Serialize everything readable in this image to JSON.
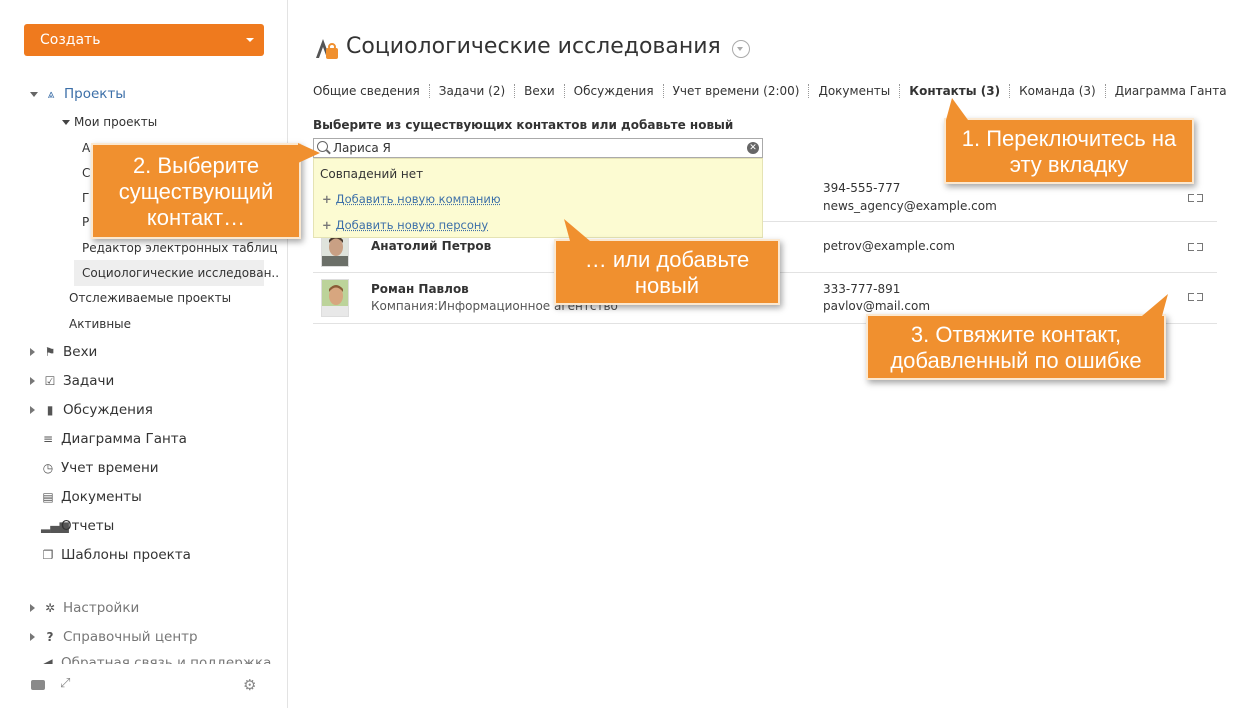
{
  "sidebar": {
    "create_label": "Создать",
    "projects_label": "Проекты",
    "my_projects_label": "Мои проекты",
    "project_items": [
      "А",
      "С",
      "Г",
      "Р",
      "Редактор электронных таблиц",
      "Социологические исследован.."
    ],
    "tracked_label": "Отслеживаемые проекты",
    "active_label": "Активные",
    "milestones_label": "Вехи",
    "tasks_label": "Задачи",
    "discussions_label": "Обсуждения",
    "gantt_label": "Диаграмма Ганта",
    "time_label": "Учет времени",
    "docs_label": "Документы",
    "reports_label": "Отчеты",
    "templates_label": "Шаблоны проекта",
    "settings_label": "Настройки",
    "help_label": "Справочный центр",
    "feedback_label": "Обратная связь и поддержка"
  },
  "page_title": "Социологические исследования",
  "tabs": [
    {
      "label": "Общие сведения"
    },
    {
      "label": "Задачи (2)"
    },
    {
      "label": "Вехи"
    },
    {
      "label": "Обсуждения"
    },
    {
      "label": "Учет времени (2:00)"
    },
    {
      "label": "Документы"
    },
    {
      "label": "Контакты (3)"
    },
    {
      "label": "Команда (3)"
    },
    {
      "label": "Диаграмма Ганта"
    }
  ],
  "hint": "Выберите из существующих контактов или добавьте новый",
  "search": {
    "value": "Лариса Я"
  },
  "dropdown": {
    "no_match": "Совпадений нет",
    "add_company": "Добавить новую компанию",
    "add_person": "Добавить новую персону"
  },
  "contacts": [
    {
      "name": "",
      "company": "",
      "phone": "394-555-777",
      "email": "news_agency@example.com"
    },
    {
      "name": "Анатолий Петров",
      "company": "",
      "phone": "",
      "email": "petrov@example.com"
    },
    {
      "name": "Роман Павлов",
      "company": "Компания:Информационное агентство",
      "phone": "333-777-891",
      "email": "pavlov@mail.com"
    }
  ],
  "callouts": {
    "one": "1. Переключитесь на эту вкладку",
    "two": "2. Выберите существующий контакт…",
    "three": "3. Отвяжите контакт, добавленный по ошибке",
    "add_new": "… или добавьте новый"
  }
}
